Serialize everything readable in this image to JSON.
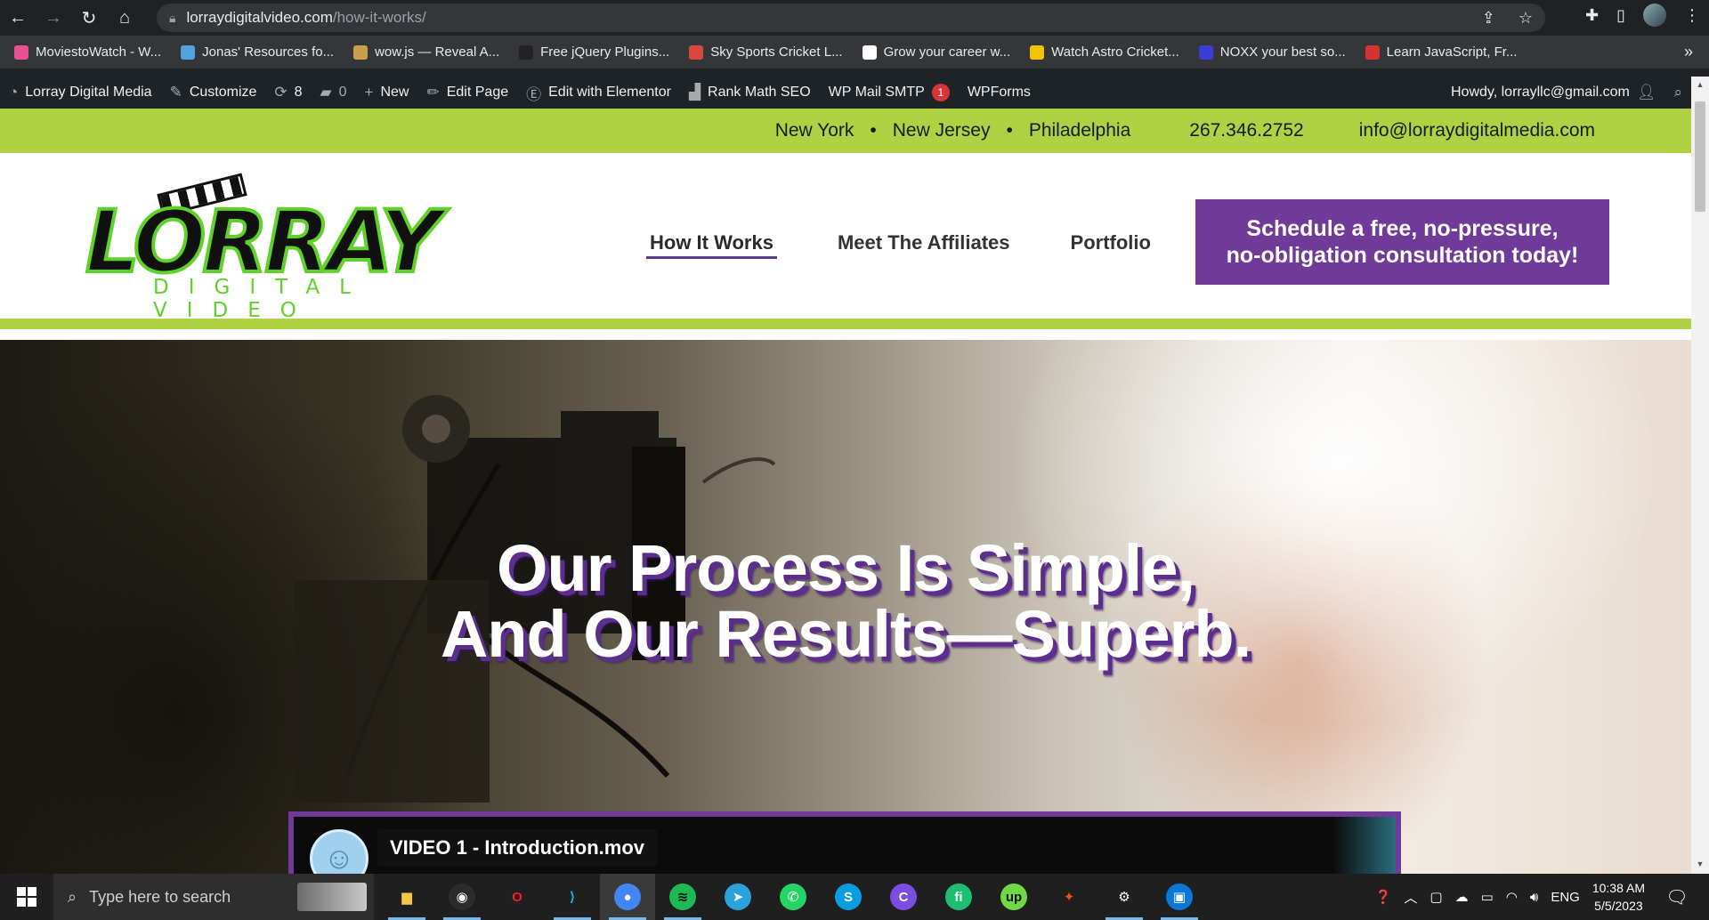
{
  "browser": {
    "url_host": "lorraydigitalvideo.com",
    "url_path": "/how-it-works/",
    "bookmarks": [
      {
        "label": "MoviestoWatch - W...",
        "color": "#e8508e"
      },
      {
        "label": "Jonas' Resources fo...",
        "color": "#4fa3e0"
      },
      {
        "label": "wow.js — Reveal A...",
        "color": "#c7a04a"
      },
      {
        "label": "Free jQuery Plugins...",
        "color": "#222222"
      },
      {
        "label": "Sky Sports Cricket L...",
        "color": "#d9483b"
      },
      {
        "label": "Grow your career w...",
        "color": "#ffffff"
      },
      {
        "label": "Watch Astro Cricket...",
        "color": "#f2c400"
      },
      {
        "label": "NOXX your best so...",
        "color": "#3b3bd6"
      },
      {
        "label": "Learn JavaScript, Fr...",
        "color": "#d6322f"
      }
    ]
  },
  "wp_admin": {
    "site": "Lorray Digital Media",
    "customize": "Customize",
    "updates": "8",
    "comments": "0",
    "new": "New",
    "edit_page": "Edit Page",
    "elementor": "Edit with Elementor",
    "rank_math": "Rank Math SEO",
    "wp_mail": "WP Mail SMTP",
    "wp_mail_badge": "1",
    "wpforms": "WPForms",
    "howdy": "Howdy, lorrayllc@gmail.com"
  },
  "site": {
    "cities": [
      "New York",
      "New Jersey",
      "Philadelphia"
    ],
    "separator": "•",
    "phone": "267.346.2752",
    "email": "info@lorraydigitalmedia.com",
    "logo_main": "LORRAY",
    "logo_sub": "DIGITAL VIDEO",
    "menu": [
      "How It Works",
      "Meet The Affiliates",
      "Portfolio"
    ],
    "cta_line1": "Schedule a free, no-pressure,",
    "cta_line2": "no-obligation consultation today!",
    "hero_line1": "Our Process Is Simple,",
    "hero_line2": "And Our Results—Superb.",
    "video_title": "VIDEO 1 - Introduction.mov",
    "colors": {
      "green": "#afd244",
      "purple": "#6f3a98",
      "logo_green": "#5fd22a"
    }
  },
  "taskbar": {
    "search_placeholder": "Type here to search",
    "language": "ENG",
    "time": "10:38 AM",
    "date": "5/5/2023",
    "apps": [
      {
        "name": "file-explorer",
        "glyph": "▆",
        "color": "#f2c744",
        "bg": "transparent"
      },
      {
        "name": "obs-studio",
        "glyph": "◉",
        "color": "#ffffff",
        "bg": "#2b2b2b"
      },
      {
        "name": "opera",
        "glyph": "O",
        "color": "#ff1b2d",
        "bg": "transparent"
      },
      {
        "name": "vscode",
        "glyph": "⟩",
        "color": "#23a9f2",
        "bg": "transparent"
      },
      {
        "name": "chrome",
        "glyph": "●",
        "color": "#ffffff",
        "bg": "#4285f4"
      },
      {
        "name": "spotify",
        "glyph": "≋",
        "color": "#111111",
        "bg": "#1db954"
      },
      {
        "name": "telegram",
        "glyph": "➤",
        "color": "#ffffff",
        "bg": "#2aa3dd"
      },
      {
        "name": "whatsapp",
        "glyph": "✆",
        "color": "#ffffff",
        "bg": "#25d366"
      },
      {
        "name": "skype",
        "glyph": "S",
        "color": "#ffffff",
        "bg": "#0a9de0"
      },
      {
        "name": "canva",
        "glyph": "C",
        "color": "#ffffff",
        "bg": "#7b4de0"
      },
      {
        "name": "fiverr",
        "glyph": "fi",
        "color": "#ffffff",
        "bg": "#1dbf73"
      },
      {
        "name": "upwork",
        "glyph": "up",
        "color": "#111111",
        "bg": "#6fda44"
      },
      {
        "name": "figma",
        "glyph": "✦",
        "color": "#f24e1e",
        "bg": "transparent"
      },
      {
        "name": "settings",
        "glyph": "⚙",
        "color": "#ffffff",
        "bg": "transparent"
      },
      {
        "name": "store",
        "glyph": "▣",
        "color": "#ffffff",
        "bg": "#0a78d7"
      }
    ]
  }
}
